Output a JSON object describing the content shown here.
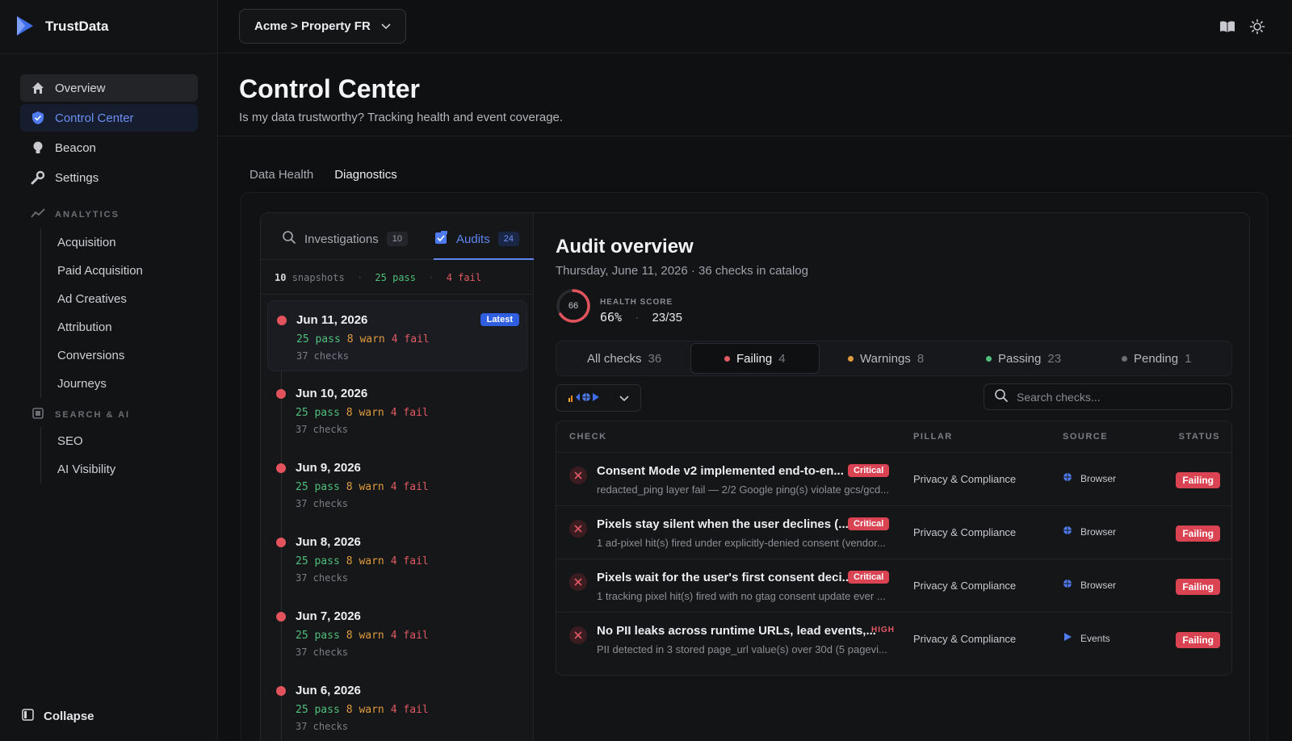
{
  "app": {
    "name": "TrustData",
    "brand_color": "#3f6ee8"
  },
  "sidebar": {
    "nav": [
      {
        "label": "Overview",
        "icon": "home-icon"
      },
      {
        "label": "Control Center",
        "icon": "shield-icon"
      },
      {
        "label": "Beacon",
        "icon": "lightbulb-icon"
      },
      {
        "label": "Settings",
        "icon": "wrench-icon"
      }
    ],
    "analytics": {
      "label": "ANALYTICS",
      "items": [
        "Acquisition",
        "Paid Acquisition",
        "Ad Creatives",
        "Attribution",
        "Conversions",
        "Journeys"
      ]
    },
    "search_ai": {
      "label": "SEARCH & AI",
      "items": [
        "SEO",
        "AI Visibility"
      ]
    },
    "collapse_label": "Collapse"
  },
  "topbar": {
    "property": "Acme > Property FR"
  },
  "page": {
    "title": "Control Center",
    "subtitle": "Is my data trustworthy? Tracking health and event coverage.",
    "tabs": [
      "Data Health",
      "Diagnostics"
    ]
  },
  "diagnostics": {
    "subtabs": [
      {
        "label": "Investigations",
        "count": "10"
      },
      {
        "label": "Audits",
        "count": "24"
      }
    ],
    "summary": {
      "snapshots": "10",
      "snapshots_label": "snapshots",
      "pass": "25 pass",
      "fail": "4 fail"
    },
    "snapshots": [
      {
        "date": "Jun 11, 2026",
        "pass": "25 pass",
        "warn": "8 warn",
        "fail": "4 fail",
        "checks": "37 checks",
        "badge": "Latest"
      },
      {
        "date": "Jun 10, 2026",
        "pass": "25 pass",
        "warn": "8 warn",
        "fail": "4 fail",
        "checks": "37 checks"
      },
      {
        "date": "Jun 9, 2026",
        "pass": "25 pass",
        "warn": "8 warn",
        "fail": "4 fail",
        "checks": "37 checks"
      },
      {
        "date": "Jun 8, 2026",
        "pass": "25 pass",
        "warn": "8 warn",
        "fail": "4 fail",
        "checks": "37 checks"
      },
      {
        "date": "Jun 7, 2026",
        "pass": "25 pass",
        "warn": "8 warn",
        "fail": "4 fail",
        "checks": "37 checks"
      },
      {
        "date": "Jun 6, 2026",
        "pass": "25 pass",
        "warn": "8 warn",
        "fail": "4 fail",
        "checks": "37 checks"
      }
    ]
  },
  "audit": {
    "title": "Audit overview",
    "subtitle": "Thursday, June 11, 2026 · 36 checks in catalog",
    "health": {
      "label": "HEALTH SCORE",
      "ring_value": "66",
      "percent": "66%",
      "ratio": "23/35",
      "score": 0.66
    },
    "filters": [
      {
        "label": "All checks",
        "count": "36"
      },
      {
        "label": "Failing",
        "count": "4",
        "color": "#e05a63"
      },
      {
        "label": "Warnings",
        "count": "8",
        "color": "#e09b3e"
      },
      {
        "label": "Passing",
        "count": "23",
        "color": "#4fbf7c"
      },
      {
        "label": "Pending",
        "count": "1",
        "color": "#6d6e75"
      }
    ],
    "search_placeholder": "Search checks...",
    "columns": [
      "CHECK",
      "PILLAR",
      "SOURCE",
      "STATUS"
    ],
    "rows": [
      {
        "title": "Consent Mode v2 implemented end-to-en...",
        "severity": "Critical",
        "desc": "redacted_ping layer fail — 2/2 Google ping(s) violate gcs/gcd...",
        "pillar": "Privacy & Compliance",
        "source": "Browser",
        "status": "Failing"
      },
      {
        "title": "Pixels stay silent when the user declines (...",
        "severity": "Critical",
        "desc": "1 ad-pixel hit(s) fired under explicitly-denied consent (vendor...",
        "pillar": "Privacy & Compliance",
        "source": "Browser",
        "status": "Failing"
      },
      {
        "title": "Pixels wait for the user's first consent deci...",
        "severity": "Critical",
        "desc": "1 tracking pixel hit(s) fired with no gtag consent update ever ...",
        "pillar": "Privacy & Compliance",
        "source": "Browser",
        "status": "Failing"
      },
      {
        "title": "No PII leaks across runtime URLs, lead events,...",
        "severity": "HIGH",
        "desc": "PII detected in 3 stored page_url value(s) over 30d (5 pagevi...",
        "pillar": "Privacy & Compliance",
        "source": "Events",
        "status": "Failing"
      }
    ]
  }
}
